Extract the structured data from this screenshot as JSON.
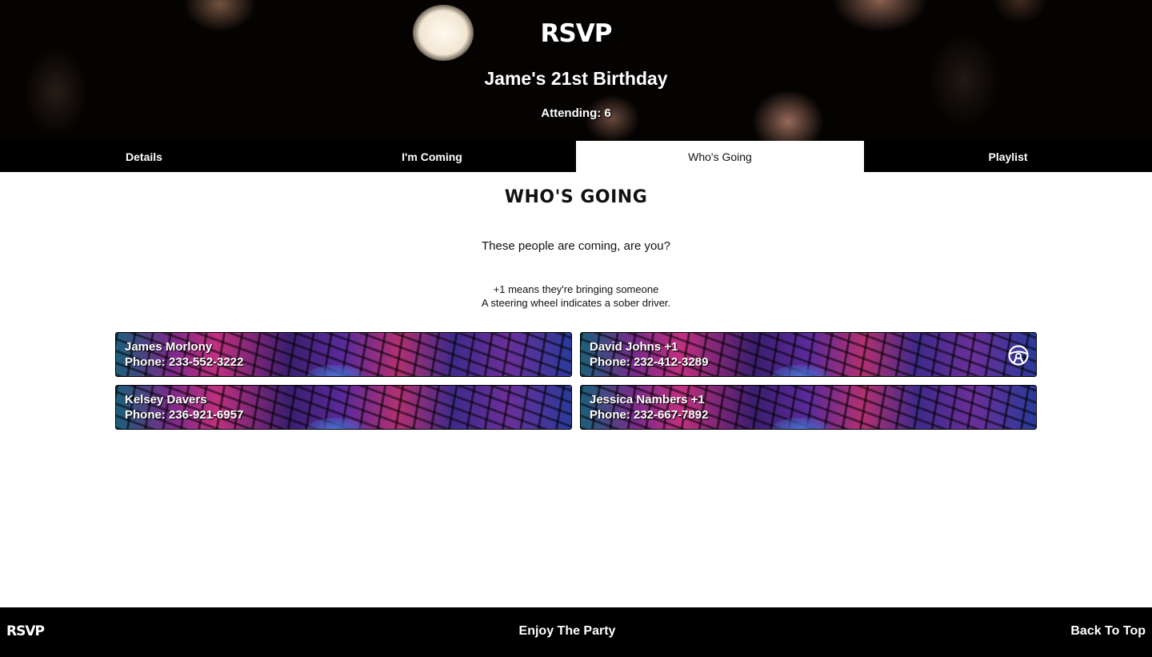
{
  "header": {
    "logo": "RSVP",
    "event_title": "Jame's 21st Birthday",
    "attending": "Attending: 6"
  },
  "tabs": [
    {
      "label": "Details",
      "active": false
    },
    {
      "label": "I'm Coming",
      "active": false
    },
    {
      "label": "Who's Going",
      "active": true
    },
    {
      "label": "Playlist",
      "active": false
    }
  ],
  "main": {
    "title": "WHO'S GOING",
    "intro": "These people are coming, are you?",
    "note_plus_one": "+1 means they're bringing someone",
    "note_driver": "A steering wheel indicates a sober driver."
  },
  "guests": [
    {
      "name": "James Morlony",
      "phone": "Phone: 233-552-3222",
      "sober_driver": false
    },
    {
      "name": "David Johns +1",
      "phone": "Phone: 232-412-3289",
      "sober_driver": true
    },
    {
      "name": "Kelsey Davers",
      "phone": "Phone: 236-921-6957",
      "sober_driver": false
    },
    {
      "name": "Jessica Nambers +1",
      "phone": "Phone: 232-667-7892",
      "sober_driver": false
    }
  ],
  "footer": {
    "logo": "RSVP",
    "tagline": "Enjoy The Party",
    "back_to_top": "Back To Top"
  },
  "icons": {
    "sober_driver": "steering-wheel-icon"
  },
  "colors": {
    "header_bg": "#050302",
    "tab_bar_bg": "#000000",
    "active_tab_bg": "#ffffff",
    "footer_bg": "#000000"
  }
}
